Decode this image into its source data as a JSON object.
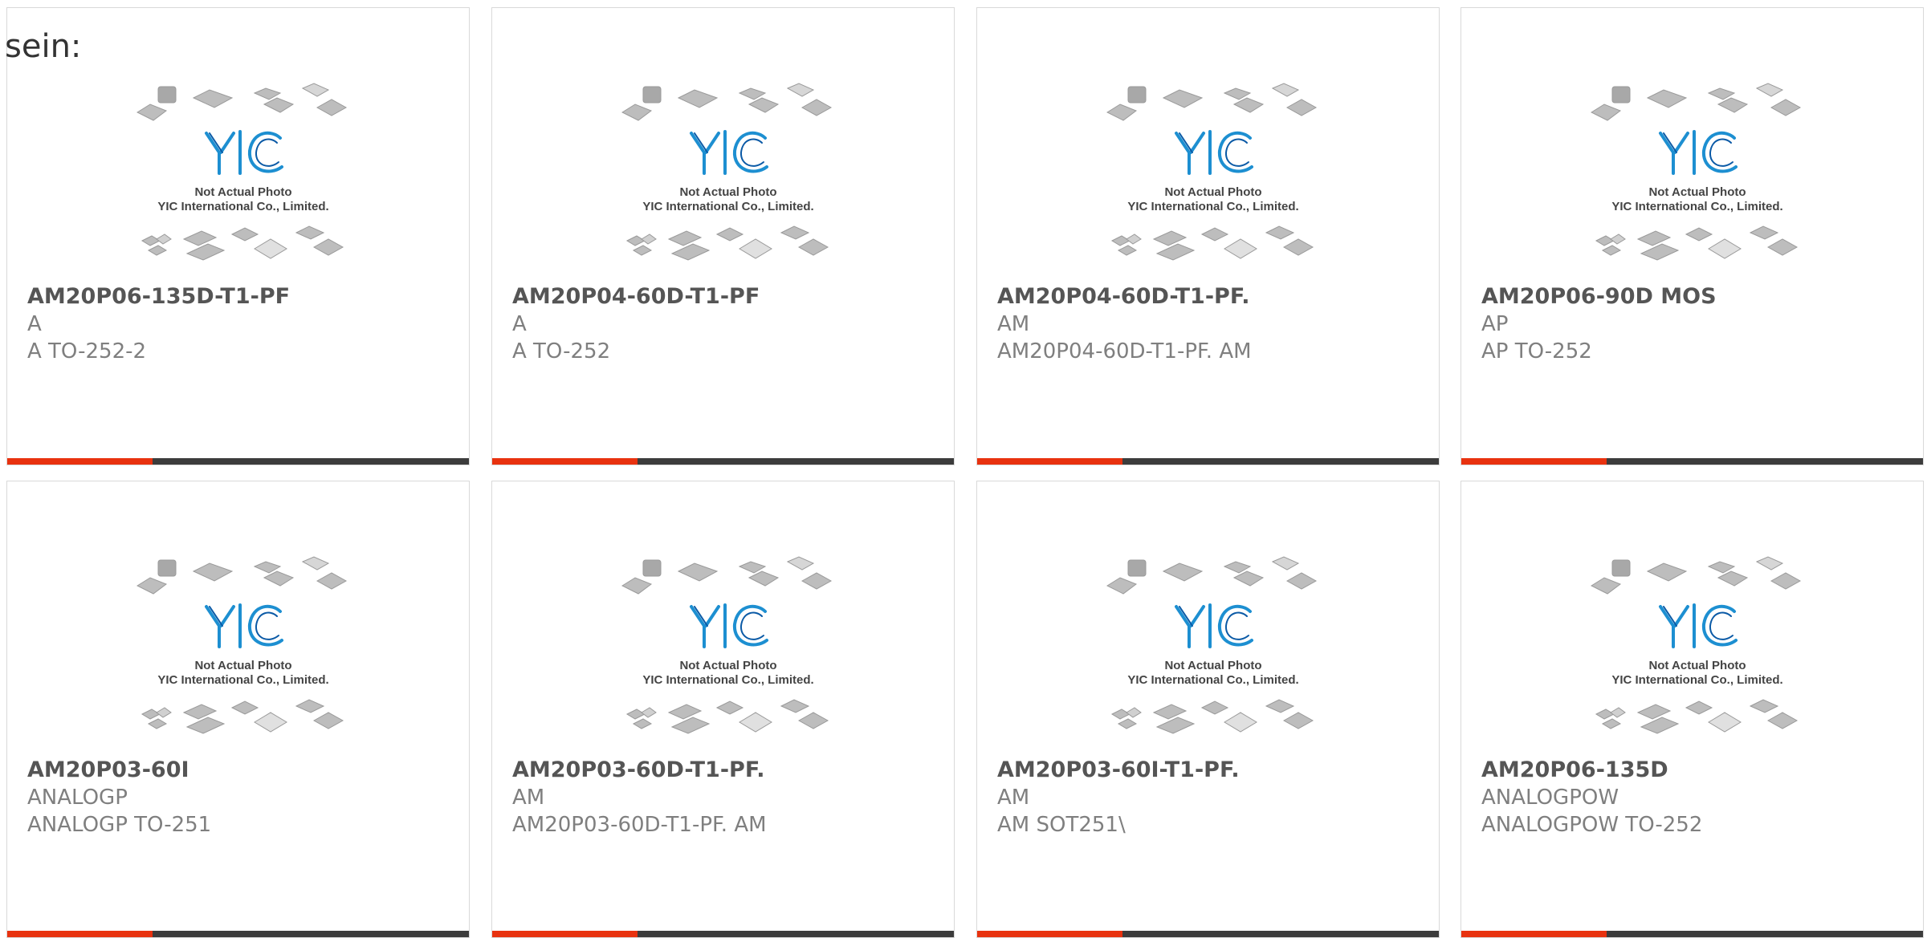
{
  "intro_text": "sein:",
  "placeholder": {
    "line1": "Not Actual Photo",
    "line2": "YIC International Co., Limited.",
    "logo_text": "YIC"
  },
  "colors": {
    "accent": "#e8320f",
    "bar_track": "#3c3c3c",
    "logo_blue": "#1d8fd1",
    "chip_gray": "#b3b3b3"
  },
  "products": [
    {
      "name": "AM20P06-135D-T1-PF",
      "maker": "A",
      "desc": "A TO-252-2"
    },
    {
      "name": "AM20P04-60D-T1-PF",
      "maker": "A",
      "desc": "A TO-252"
    },
    {
      "name": "AM20P04-60D-T1-PF.",
      "maker": "AM",
      "desc": "AM20P04-60D-T1-PF. AM"
    },
    {
      "name": "AM20P06-90D MOS",
      "maker": "AP",
      "desc": "AP TO-252"
    },
    {
      "name": "AM20P03-60I",
      "maker": "ANALOGP",
      "desc": "ANALOGP TO-251"
    },
    {
      "name": "AM20P03-60D-T1-PF.",
      "maker": "AM",
      "desc": "AM20P03-60D-T1-PF. AM"
    },
    {
      "name": "AM20P03-60I-T1-PF.",
      "maker": "AM",
      "desc": "AM SOT251\\"
    },
    {
      "name": "AM20P06-135D",
      "maker": "ANALOGPOW",
      "desc": "ANALOGPOW TO-252"
    }
  ]
}
